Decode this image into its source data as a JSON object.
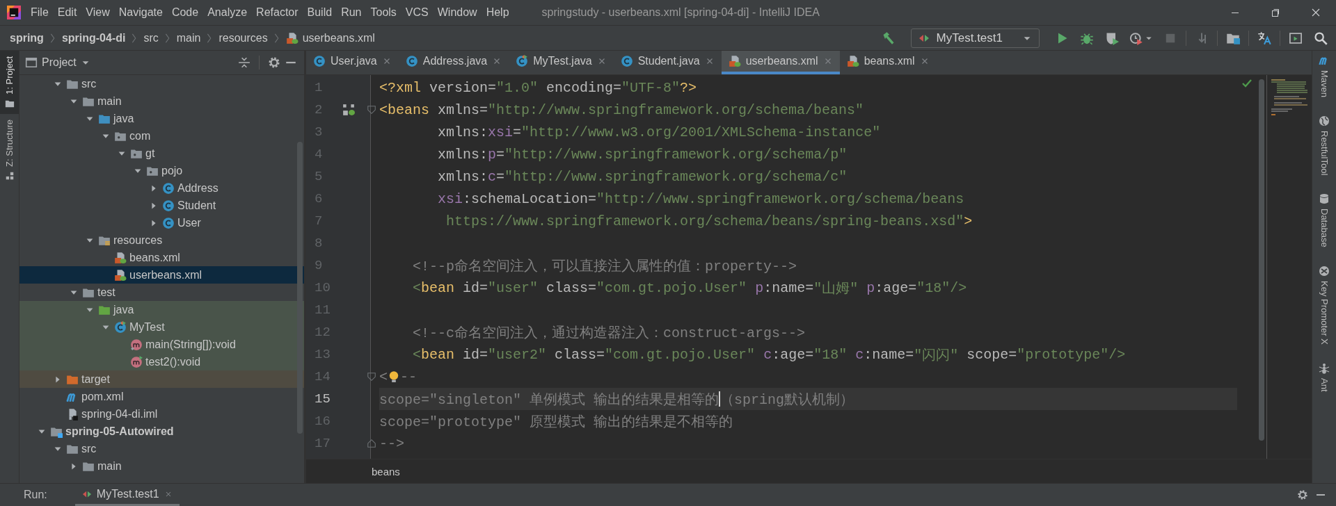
{
  "menu": [
    "File",
    "Edit",
    "View",
    "Navigate",
    "Code",
    "Analyze",
    "Refactor",
    "Build",
    "Run",
    "Tools",
    "VCS",
    "Window",
    "Help"
  ],
  "window_title": "springstudy - userbeans.xml [spring-04-di] - IntelliJ IDEA",
  "breadcrumb": [
    {
      "label": "spring",
      "kind": "module"
    },
    {
      "label": "spring-04-di",
      "kind": "module"
    },
    {
      "label": "src",
      "kind": "folder"
    },
    {
      "label": "main",
      "kind": "folder"
    },
    {
      "label": "resources",
      "kind": "folder"
    },
    {
      "label": "userbeans.xml",
      "kind": "xml"
    }
  ],
  "run_config": "MyTest.test1",
  "side_left": [
    {
      "label": "1: Project",
      "selected": true
    },
    {
      "label": "Z: Structure",
      "selected": false
    }
  ],
  "project_panel": {
    "title": "Project",
    "tree": [
      {
        "children": [
          {
            "label": "src",
            "kind": "folder",
            "expanded": true,
            "selected": false,
            "children": [
              {
                "label": "main",
                "kind": "folder",
                "expanded": true,
                "selected": false,
                "children": [
                  {
                    "label": "java",
                    "kind": "source-folder",
                    "expanded": true,
                    "selected": false,
                    "children": [
                      {
                        "label": "com",
                        "kind": "package",
                        "expanded": true,
                        "selected": false,
                        "children": [
                          {
                            "label": "gt",
                            "kind": "package",
                            "expanded": true,
                            "selected": false,
                            "children": [
                              {
                                "label": "pojo",
                                "kind": "package",
                                "expanded": true,
                                "selected": false,
                                "children": [
                                  {
                                    "label": "Address",
                                    "kind": "class",
                                    "expanded": false,
                                    "selected": false
                                  },
                                  {
                                    "label": "Student",
                                    "kind": "class",
                                    "expanded": false,
                                    "selected": false
                                  },
                                  {
                                    "label": "User",
                                    "kind": "class",
                                    "expanded": false,
                                    "selected": false
                                  }
                                ]
                              }
                            ]
                          }
                        ]
                      }
                    ]
                  },
                  {
                    "label": "resources",
                    "kind": "resources",
                    "expanded": true,
                    "selected": false,
                    "children": [
                      {
                        "label": "beans.xml",
                        "kind": "xml",
                        "selected": false
                      },
                      {
                        "label": "userbeans.xml",
                        "kind": "xml",
                        "selected": true
                      }
                    ]
                  }
                ]
              },
              {
                "label": "test",
                "kind": "folder",
                "expanded": true,
                "selected": false,
                "children": [
                  {
                    "label": "java",
                    "kind": "test-folder",
                    "expanded": true,
                    "selected": false,
                    "test": true,
                    "children": [
                      {
                        "label": "MyTest",
                        "kind": "test-class",
                        "expanded": true,
                        "selected": false,
                        "test": true,
                        "children": [
                          {
                            "label": "main(String[]):void",
                            "kind": "method",
                            "selected": false,
                            "test": true
                          },
                          {
                            "label": "test2():void",
                            "kind": "test-method",
                            "selected": false,
                            "test": true
                          }
                        ]
                      }
                    ]
                  }
                ]
              }
            ]
          },
          {
            "label": "target",
            "kind": "target",
            "expanded": false,
            "selected": false,
            "excluded": true
          },
          {
            "label": "pom.xml",
            "kind": "maven",
            "selected": false
          },
          {
            "label": "spring-04-di.iml",
            "kind": "iml",
            "selected": false
          }
        ]
      },
      {
        "label": "spring-05-Autowired",
        "kind": "module",
        "expanded": true,
        "selected": false,
        "children": [
          {
            "label": "src",
            "kind": "folder",
            "expanded": true,
            "selected": false,
            "children": [
              {
                "label": "main",
                "kind": "folder",
                "expanded": false,
                "selected": false
              }
            ]
          }
        ]
      }
    ]
  },
  "tabs": [
    {
      "label": "User.java",
      "kind": "class",
      "selected": false
    },
    {
      "label": "Address.java",
      "kind": "class",
      "selected": false
    },
    {
      "label": "MyTest.java",
      "kind": "test-class",
      "selected": false
    },
    {
      "label": "Student.java",
      "kind": "class",
      "selected": false
    },
    {
      "label": "userbeans.xml",
      "kind": "xml",
      "selected": true
    },
    {
      "label": "beans.xml",
      "kind": "xml",
      "selected": false
    }
  ],
  "editor": {
    "lines": [
      {
        "number": "1",
        "current": false,
        "tokens": [
          {
            "kind": "tag",
            "text": "<?xml"
          },
          {
            "kind": "attr",
            "text": " version="
          },
          {
            "kind": "value",
            "text": "\"1.0\""
          },
          {
            "kind": "attr",
            "text": " encoding="
          },
          {
            "kind": "value",
            "text": "\"UTF-8\""
          },
          {
            "kind": "tag",
            "text": "?>"
          }
        ]
      },
      {
        "number": "2",
        "current": false,
        "bean_icon": true,
        "fold_start": true,
        "tokens": [
          {
            "kind": "tag",
            "text": "<beans"
          },
          {
            "kind": "attr",
            "text": " xmlns="
          },
          {
            "kind": "value",
            "text": "\"http://www.springframework.org/schema/beans\""
          }
        ]
      },
      {
        "number": "3",
        "current": false,
        "tokens": [
          {
            "kind": "attr",
            "text": "       xmlns:"
          },
          {
            "kind": "ns",
            "text": "xsi"
          },
          {
            "kind": "attr",
            "text": "="
          },
          {
            "kind": "value",
            "text": "\"http://www.w3.org/2001/XMLSchema-instance\""
          }
        ]
      },
      {
        "number": "4",
        "current": false,
        "tokens": [
          {
            "kind": "attr",
            "text": "       xmlns:"
          },
          {
            "kind": "ns",
            "text": "p"
          },
          {
            "kind": "attr",
            "text": "="
          },
          {
            "kind": "value",
            "text": "\"http://www.springframework.org/schema/p\""
          }
        ]
      },
      {
        "number": "5",
        "current": false,
        "tokens": [
          {
            "kind": "attr",
            "text": "       xmlns:"
          },
          {
            "kind": "ns",
            "text": "c"
          },
          {
            "kind": "attr",
            "text": "="
          },
          {
            "kind": "value",
            "text": "\"http://www.springframework.org/schema/c\""
          }
        ]
      },
      {
        "number": "6",
        "current": false,
        "tokens": [
          {
            "kind": "ns",
            "text": "       xsi"
          },
          {
            "kind": "attr",
            "text": ":schemaLocation="
          },
          {
            "kind": "value",
            "text": "\"http://www.springframework.org/schema/beans"
          }
        ]
      },
      {
        "number": "7",
        "current": false,
        "tokens": [
          {
            "kind": "value",
            "text": "        https://www.springframework.org/schema/beans/spring-beans.xsd\""
          },
          {
            "kind": "tag",
            "text": ">"
          }
        ]
      },
      {
        "number": "8",
        "current": false
      },
      {
        "number": "9",
        "current": false,
        "tokens": [
          {
            "kind": "comment",
            "text": "    <!--p命名空间注入，可以直接注入属性的值：property-->"
          }
        ]
      },
      {
        "number": "10",
        "current": false,
        "tokens": [
          {
            "kind": "bracket",
            "text": "    <"
          },
          {
            "kind": "tag",
            "text": "bean"
          },
          {
            "kind": "attr",
            "text": " id="
          },
          {
            "kind": "value",
            "text": "\"user\""
          },
          {
            "kind": "attr",
            "text": " class="
          },
          {
            "kind": "value",
            "text": "\"com.gt.pojo.User\" "
          },
          {
            "kind": "ns",
            "text": "p"
          },
          {
            "kind": "attr",
            "text": ":name="
          },
          {
            "kind": "value",
            "text": "\"山姆\" "
          },
          {
            "kind": "ns",
            "text": "p"
          },
          {
            "kind": "attr",
            "text": ":age="
          },
          {
            "kind": "value",
            "text": "\"18\""
          },
          {
            "kind": "bracket",
            "text": "/>"
          }
        ]
      },
      {
        "number": "11",
        "current": false
      },
      {
        "number": "12",
        "current": false,
        "tokens": [
          {
            "kind": "comment",
            "text": "    <!--c命名空间注入，通过构造器注入：construct-args-->"
          }
        ]
      },
      {
        "number": "13",
        "current": false,
        "tokens": [
          {
            "kind": "bracket",
            "text": "    <"
          },
          {
            "kind": "tag",
            "text": "bean"
          },
          {
            "kind": "attr",
            "text": " id="
          },
          {
            "kind": "value",
            "text": "\"user2\""
          },
          {
            "kind": "attr",
            "text": " class="
          },
          {
            "kind": "value",
            "text": "\"com.gt.pojo.User\" "
          },
          {
            "kind": "ns",
            "text": "c"
          },
          {
            "kind": "attr",
            "text": ":age="
          },
          {
            "kind": "value",
            "text": "\"18\" "
          },
          {
            "kind": "ns",
            "text": "c"
          },
          {
            "kind": "attr",
            "text": ":name="
          },
          {
            "kind": "value",
            "text": "\"闪闪\""
          },
          {
            "kind": "attr",
            "text": " scope="
          },
          {
            "kind": "value",
            "text": "\"prototype\""
          },
          {
            "kind": "bracket",
            "text": "/>"
          }
        ]
      },
      {
        "number": "14",
        "current": false,
        "fold_start": true,
        "tokens": [
          {
            "kind": "comment",
            "text": "<"
          },
          {
            "kind": "bulb"
          },
          {
            "kind": "comment",
            "text": "--"
          }
        ]
      },
      {
        "number": "15",
        "current": true,
        "tokens": [
          {
            "kind": "comment",
            "text": "scope=\"singleton\" 单例模式 输出的结果是相等的"
          },
          {
            "kind": "caret"
          },
          {
            "kind": "comment",
            "text": "（spring默认机制）"
          }
        ]
      },
      {
        "number": "16",
        "current": false,
        "tokens": [
          {
            "kind": "comment",
            "text": "scope=\"prototype\" 原型模式 输出的结果是不相等的"
          }
        ]
      },
      {
        "number": "17",
        "current": false,
        "fold_end": true,
        "tokens": [
          {
            "kind": "comment",
            "text": "-->"
          }
        ]
      }
    ],
    "breadcrumb": "beans"
  },
  "side_right": [
    {
      "label": "Maven",
      "kind": "maven"
    },
    {
      "label": "RestfulTool",
      "kind": "globe"
    },
    {
      "label": "Database",
      "kind": "database"
    },
    {
      "label": "Key Promoter X",
      "kind": "key-promoter"
    },
    {
      "label": "Ant",
      "kind": "ant"
    }
  ],
  "run_bar": {
    "label": "Run:",
    "tab": "MyTest.test1"
  }
}
